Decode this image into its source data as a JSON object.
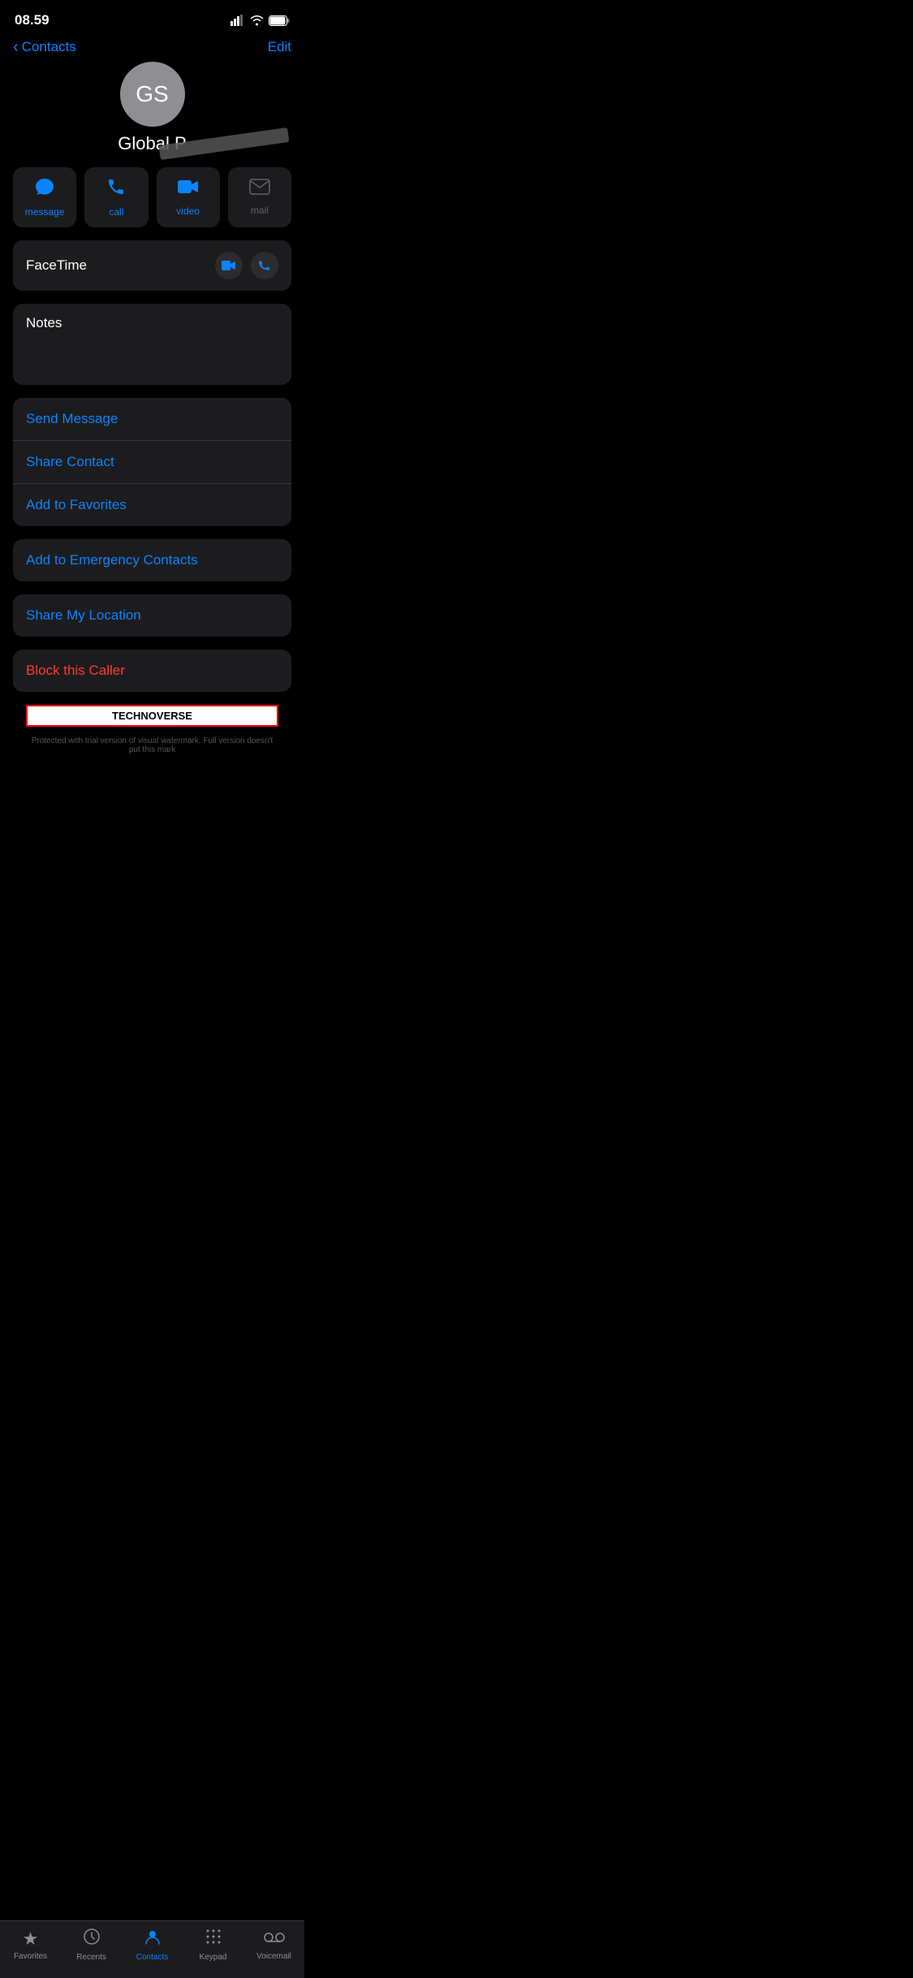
{
  "statusBar": {
    "time": "08.59"
  },
  "navBar": {
    "backLabel": "Contacts",
    "editLabel": "Edit"
  },
  "contact": {
    "initials": "GS",
    "name": "Global P"
  },
  "actionButtons": [
    {
      "id": "message",
      "icon": "💬",
      "label": "message",
      "active": true
    },
    {
      "id": "call",
      "icon": "📞",
      "label": "call",
      "active": true
    },
    {
      "id": "video",
      "icon": "📹",
      "label": "video",
      "active": true
    },
    {
      "id": "mail",
      "icon": "✉️",
      "label": "mail",
      "active": false
    }
  ],
  "facetime": {
    "label": "FaceTime"
  },
  "notes": {
    "label": "Notes"
  },
  "actionList": [
    {
      "id": "send-message",
      "label": "Send Message"
    },
    {
      "id": "share-contact",
      "label": "Share Contact"
    },
    {
      "id": "add-to-favorites",
      "label": "Add to Favorites"
    }
  ],
  "singleActions": [
    {
      "id": "add-emergency",
      "label": "Add to Emergency Contacts",
      "danger": false
    },
    {
      "id": "share-location",
      "label": "Share My Location",
      "danger": false
    },
    {
      "id": "block-caller",
      "label": "Block this Caller",
      "danger": true
    }
  ],
  "tabBar": {
    "items": [
      {
        "id": "favorites",
        "icon": "★",
        "label": "Favorites",
        "active": false
      },
      {
        "id": "recents",
        "icon": "🕐",
        "label": "Recents",
        "active": false
      },
      {
        "id": "contacts",
        "icon": "👤",
        "label": "Contacts",
        "active": true
      },
      {
        "id": "keypad",
        "icon": "⠿",
        "label": "Keypad",
        "active": false
      },
      {
        "id": "voicemail",
        "icon": "⊚",
        "label": "Voicemail",
        "active": false
      }
    ]
  },
  "watermark": {
    "brand": "TECHNOVERSE",
    "disclaimer": "Protected with trial version of visual watermark. Full version doesn't put this mark"
  }
}
